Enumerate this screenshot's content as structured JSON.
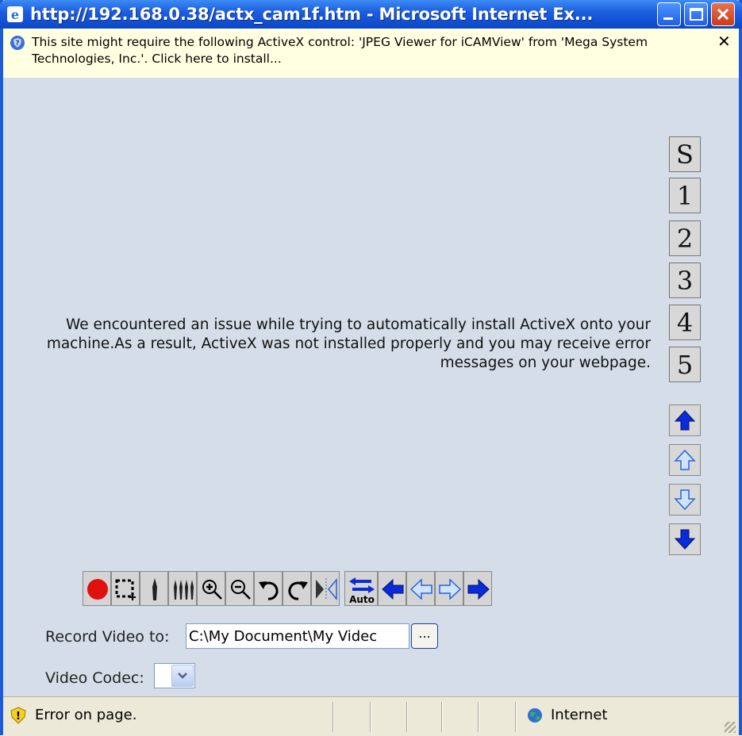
{
  "window": {
    "title": "http://192.168.0.38/actx_cam1f.htm - Microsoft Internet Ex...",
    "accent": "#1e5bd6"
  },
  "infobar": {
    "text": "This site might require the following ActiveX control: 'JPEG Viewer for iCAMView' from 'Mega System Technologies, Inc.'. Click here to install...",
    "close": "✕"
  },
  "main": {
    "message": "We encountered an issue while trying to automatically install ActiveX onto your machine.As a result, ActiveX was not installed properly and you may receive error messages on your webpage.",
    "presets": [
      "S",
      "1",
      "2",
      "3",
      "4",
      "5"
    ],
    "tilt_buttons": [
      "tilt-up-fast-icon",
      "tilt-up-icon",
      "tilt-down-icon",
      "tilt-down-fast-icon"
    ],
    "toolbar": [
      "record-icon",
      "select-area-icon",
      "single-focus-icon",
      "multi-focus-icon",
      "zoom-in-icon",
      "zoom-out-icon",
      "rotate-left-icon",
      "rotate-right-icon",
      "mirror-icon",
      "auto-pan-icon",
      "pan-left-fast-icon",
      "pan-left-icon",
      "pan-right-icon",
      "pan-right-fast-icon"
    ],
    "auto_label": "Auto"
  },
  "record": {
    "label": "Record Video to:",
    "value": "C:\\My Document\\My Videc",
    "browse": "..."
  },
  "codec": {
    "label": "Video Codec:",
    "value": ""
  },
  "status": {
    "text": "Error on page.",
    "zone": "Internet"
  }
}
